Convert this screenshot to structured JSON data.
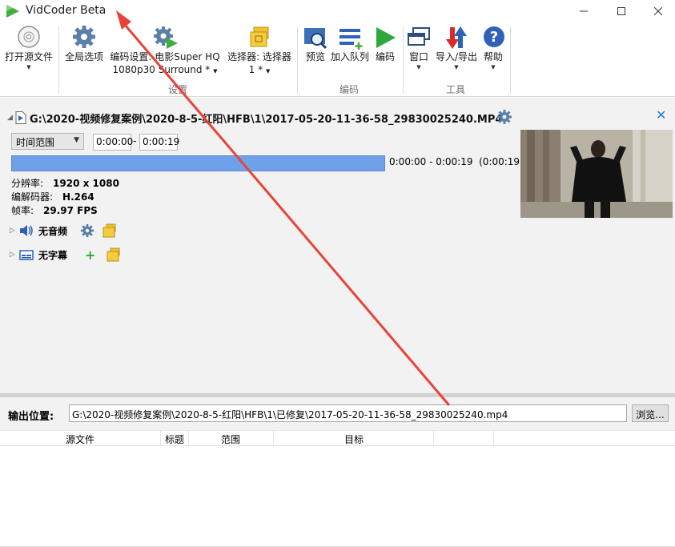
{
  "window": {
    "title": "VidCoder Beta",
    "minimize_icon": "minimize-icon",
    "maximize_icon": "maximize-icon",
    "close_icon": "close-icon"
  },
  "ribbon": {
    "open_source": {
      "label": "打开源文件",
      "icon": "disc-icon"
    },
    "global_options": {
      "label": "全局选项",
      "icon": "gear-icon"
    },
    "encode_settings": {
      "label_line1": "编码设置: 电影Super HQ",
      "label_line2": "1080p30 Surround *",
      "icon": "gear-play-icon"
    },
    "picker": {
      "label_line1": "选择器: 选择器",
      "label_line2": "1 *",
      "icon": "folder-stack-icon"
    },
    "settings_group": "设置",
    "preview": {
      "label": "预览",
      "icon": "preview-icon"
    },
    "add_queue": {
      "label": "加入队列",
      "icon": "add-queue-icon"
    },
    "encode": {
      "label": "编码",
      "icon": "play-icon"
    },
    "encode_group": "编码",
    "window_menu": {
      "label": "窗口",
      "icon": "windows-icon"
    },
    "import_export": {
      "label": "导入/导出",
      "icon": "import-export-icon"
    },
    "help": {
      "label": "帮助",
      "icon": "help-icon"
    },
    "tools_group": "工具"
  },
  "source": {
    "path": "G:\\2020-视频修复案例\\2020-8-5-红阳\\HFB\\1\\2017-05-20-11-36-58_29830025240.MP4",
    "range_type": "时间范围",
    "start_time": "0:00:00",
    "end_time": "0:00:19",
    "range_summary": "0:00:00 - 0:00:19",
    "range_duration": "(0:00:19)",
    "range_fill_fraction": 1.0,
    "resolution_label": "分辨率:",
    "resolution_value": "1920 x 1080",
    "codec_label": "编解码器:",
    "codec_value": "H.264",
    "fps_label": "帧率:",
    "fps_value": "29.97 FPS",
    "audio_label": "无音频",
    "subtitle_label": "无字幕"
  },
  "output": {
    "label": "输出位置:",
    "path": "G:\\2020-视频修复案例\\2020-8-5-红阳\\HFB\\1\\已修复\\2017-05-20-11-36-58_29830025240.mp4",
    "browse_label": "浏览..."
  },
  "queue": {
    "columns": [
      "源文件",
      "标题",
      "范围",
      "目标"
    ]
  },
  "colors": {
    "range_bar": "#6fa1e8",
    "accent_blue": "#2a7ad4",
    "annotation_arrow": "#e8433a"
  }
}
